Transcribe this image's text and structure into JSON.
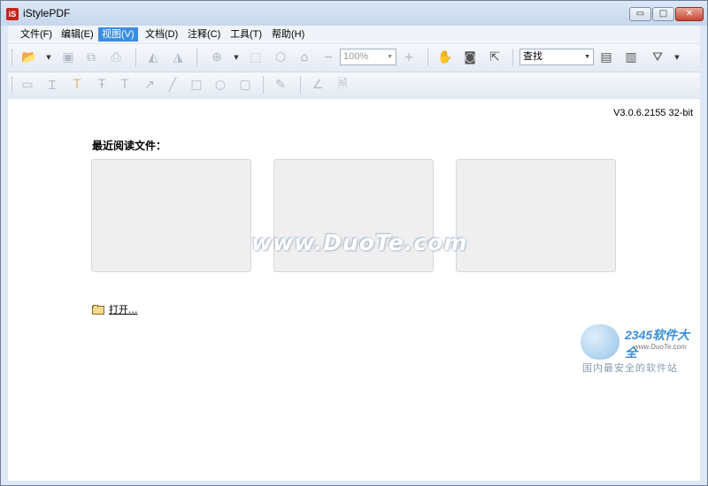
{
  "window": {
    "title": "iStylePDF",
    "app_icon_text": "iS",
    "controls": {
      "minimize": "▭",
      "maximize": "□",
      "close": "✕"
    }
  },
  "menu": {
    "items": [
      {
        "label": "文件(F)"
      },
      {
        "label": "编辑(E)"
      },
      {
        "label": "视图(V)",
        "active": true
      },
      {
        "label": "文档(D)"
      },
      {
        "label": "注释(C)"
      },
      {
        "label": "工具(T)"
      },
      {
        "label": "帮助(H)"
      }
    ]
  },
  "toolbar": {
    "zoom_value": "100%",
    "search_placeholder": "查找"
  },
  "content": {
    "version": "V3.0.6.2155 32-bit",
    "recent_title": "最近阅读文件：",
    "open_label": "打开..."
  },
  "watermark": {
    "main": "www.DuoTe.com",
    "brand": "2345软件大全",
    "url": "www.DuoTe.com",
    "slogan": "国内最安全的软件站"
  },
  "colors": {
    "menu_active": "#3a8de0",
    "close_button": "#c84531",
    "content_bg": "#ffffff",
    "thumb_bg": "#efefef"
  },
  "icons": [
    "open-folder-icon",
    "save-icon",
    "save-all-icon",
    "print-icon",
    "rotate-left-icon",
    "rotate-right-icon",
    "zoom-in-icon",
    "fit-page-icon",
    "fit-width-icon",
    "actual-size-icon",
    "zoom-out-icon",
    "zoom-plus-icon",
    "hand-icon",
    "snapshot-icon",
    "select-icon",
    "bookmark-icon",
    "page-icon",
    "stamp-icon",
    "note-icon",
    "text-select-icon",
    "highlight-icon",
    "strikethrough-icon",
    "underline-icon",
    "arrow-icon",
    "line-icon",
    "rectangle-icon",
    "ellipse-icon",
    "textbox-icon",
    "pencil-icon",
    "sign-icon",
    "attach-icon"
  ]
}
